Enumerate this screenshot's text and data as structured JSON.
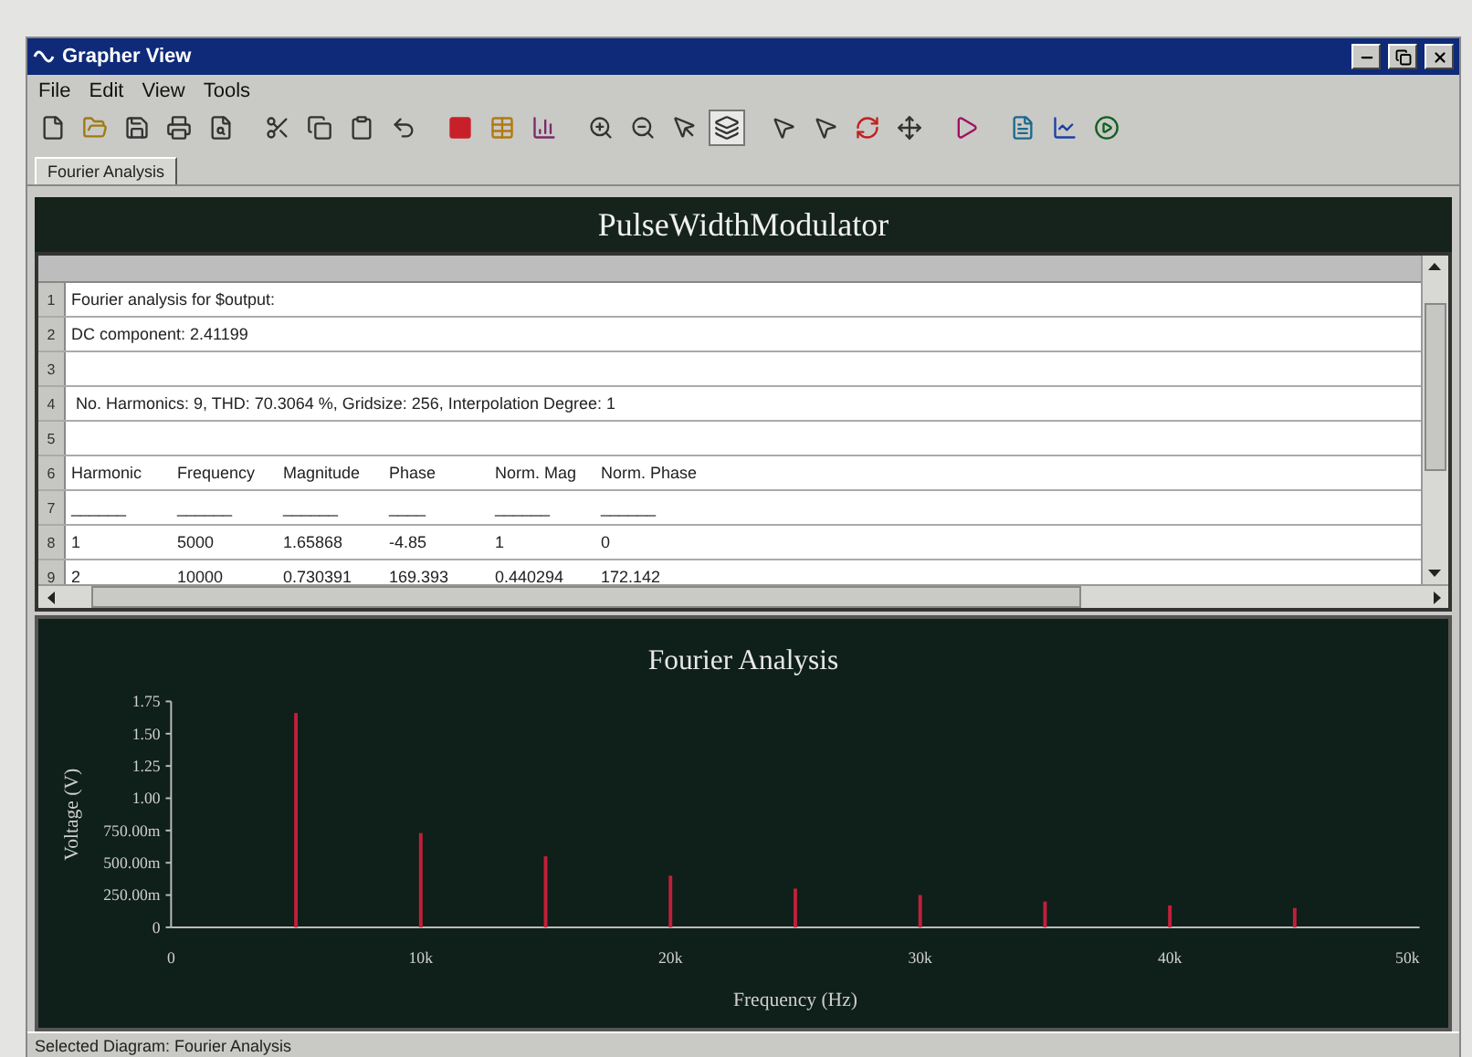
{
  "window": {
    "title": "Grapher View"
  },
  "menu": [
    "File",
    "Edit",
    "View",
    "Tools"
  ],
  "toolbar": [
    {
      "kind": "new",
      "pressed": false
    },
    {
      "kind": "open",
      "pressed": false
    },
    {
      "kind": "save",
      "pressed": false
    },
    {
      "kind": "print",
      "pressed": false
    },
    {
      "kind": "preview",
      "pressed": false
    },
    {
      "kind": "cut",
      "pressed": false
    },
    {
      "kind": "copy",
      "pressed": false
    },
    {
      "kind": "paste",
      "pressed": false
    },
    {
      "kind": "undo",
      "pressed": false
    },
    {
      "kind": "red",
      "pressed": false
    },
    {
      "kind": "table",
      "pressed": false
    },
    {
      "kind": "bars",
      "pressed": false
    },
    {
      "kind": "zoomin",
      "pressed": false
    },
    {
      "kind": "zoomout",
      "pressed": false
    },
    {
      "kind": "pointer",
      "pressed": false
    },
    {
      "kind": "layers",
      "pressed": true
    },
    {
      "kind": "cursor",
      "pressed": false
    },
    {
      "kind": "cursor2",
      "pressed": false
    },
    {
      "kind": "refresh",
      "pressed": false
    },
    {
      "kind": "move",
      "pressed": false
    },
    {
      "kind": "export",
      "pressed": false
    },
    {
      "kind": "doc",
      "pressed": false
    },
    {
      "kind": "chart",
      "pressed": false
    },
    {
      "kind": "play",
      "pressed": false
    }
  ],
  "tabs": [
    {
      "label": "Fourier Analysis",
      "selected": true
    }
  ],
  "diagram_title": "PulseWidthModulator",
  "grid": {
    "rows": [
      {
        "number": "1",
        "cells": [
          "Fourier analysis for $output:"
        ]
      },
      {
        "number": "2",
        "cells": [
          "DC component: 2.41199"
        ]
      },
      {
        "number": "3",
        "cells": []
      },
      {
        "number": "4",
        "cells": [
          " No. Harmonics: 9, THD: 70.3064 %, Gridsize: 256, Interpolation Degree: 1"
        ]
      },
      {
        "number": "5",
        "cells": []
      },
      {
        "number": "6",
        "cells": [
          "Harmonic",
          "Frequency",
          "Magnitude",
          "Phase",
          "Norm. Mag",
          "Norm. Phase"
        ]
      },
      {
        "number": "7",
        "cells": [
          "______",
          "______",
          "______",
          "____",
          "______",
          "______"
        ]
      },
      {
        "number": "8",
        "cells": [
          "1",
          "5000",
          "1.65868",
          "-4.85",
          "1",
          "0"
        ]
      },
      {
        "number": "9",
        "cells": [
          "2",
          "10000",
          "0.730391",
          "169.393",
          "0.440294",
          "172.142"
        ]
      }
    ]
  },
  "chart": {
    "chart_data": {
      "type": "bar",
      "title": "Fourier Analysis",
      "xlabel": "Frequency (Hz)",
      "ylabel": "Voltage (V)",
      "x": [
        5000,
        10000,
        15000,
        20000,
        25000,
        30000,
        35000,
        40000,
        45000
      ],
      "series": [
        {
          "color": "#c0203a",
          "values": [
            1.66,
            0.73,
            0.55,
            0.4,
            0.3,
            0.25,
            0.2,
            0.17,
            0.15
          ]
        }
      ],
      "xlim": [
        0,
        50000
      ],
      "ylim": [
        0,
        1.75
      ],
      "xticks": [
        {
          "value": 0,
          "label": "0"
        },
        {
          "value": 10000,
          "label": "10k"
        },
        {
          "value": 20000,
          "label": "20k"
        },
        {
          "value": 30000,
          "label": "30k"
        },
        {
          "value": 40000,
          "label": "40k"
        },
        {
          "value": 50000,
          "label": "50k"
        }
      ],
      "yticks": [
        {
          "value": 0,
          "label": "0"
        },
        {
          "value": 1,
          "label": "1.00"
        },
        {
          "value": 1.25,
          "label": "1.25"
        },
        {
          "value": 1.5,
          "label": "1.50"
        },
        {
          "value": 1.75,
          "label": "1.75"
        }
      ]
    }
  },
  "milli_y_labels": [
    "750.00m",
    "500.00m",
    "250.00m"
  ],
  "status_bar": "Selected Diagram:  Fourier Analysis"
}
